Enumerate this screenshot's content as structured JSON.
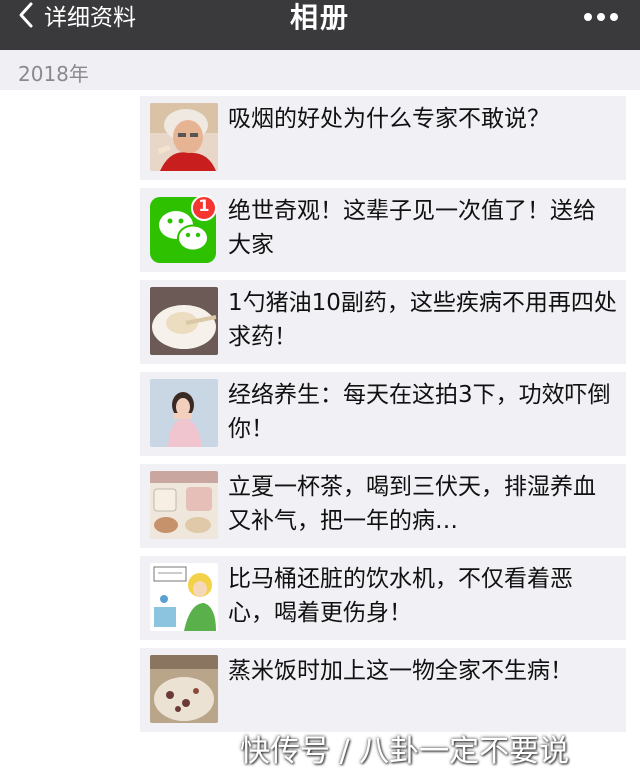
{
  "nav": {
    "back_label": "详细资料",
    "title": "相册"
  },
  "year_label": "2018年",
  "items": [
    {
      "text": "吸烟的好处为什么专家不敢说？",
      "thumb": "elderly-woman-photo"
    },
    {
      "text": "绝世奇观！这辈子见一次值了！送给大家",
      "thumb": "wechat-logo",
      "badge": "1"
    },
    {
      "text": "1勺猪油10副药，这些疾病不用再四处求药！",
      "thumb": "lard-bowl-photo"
    },
    {
      "text": "经络养生：每天在这拍3下，功效吓倒你！",
      "thumb": "girl-pink-photo"
    },
    {
      "text": "立夏一杯茶，喝到三伏天，排湿养血又补气，把一年的病…",
      "thumb": "tea-cups-photo"
    },
    {
      "text": "比马桶还脏的饮水机，不仅看着恶心，喝着更伤身！",
      "thumb": "water-dispenser-cartoon"
    },
    {
      "text": "蒸米饭时加上这一物全家不生病！",
      "thumb": "rice-dish-photo"
    }
  ],
  "watermark": "快传号 / 八卦一定不要说",
  "colors": {
    "navbar": "#3a3a3c",
    "year_bar": "#efeff4",
    "item_bg": "#f0f0f5",
    "wechat_green": "#2dc100",
    "badge_red": "#f43530"
  }
}
